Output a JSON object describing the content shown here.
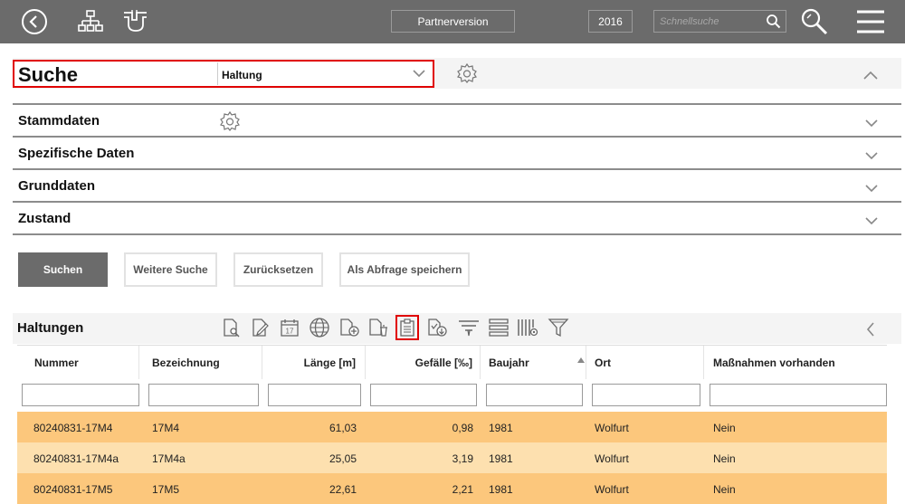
{
  "topbar": {
    "partner_label": "Partnerversion",
    "year": "2016",
    "quicksearch_placeholder": "Schnellsuche",
    "icons": [
      "back-icon",
      "network-icon",
      "pipe-icon",
      "search-icon",
      "zoom-search-icon",
      "menu-icon"
    ]
  },
  "search": {
    "title": "Suche",
    "selected": "Haltung"
  },
  "sections": [
    {
      "label": "Stammdaten"
    },
    {
      "label": "Spezifische Daten"
    },
    {
      "label": "Grunddaten"
    },
    {
      "label": "Zustand"
    }
  ],
  "buttons": {
    "search": "Suchen",
    "more": "Weitere Suche",
    "reset": "Zurücksetzen",
    "save_query": "Als Abfrage speichern"
  },
  "list": {
    "title": "Haltungen",
    "toolbar": [
      "document-search-icon",
      "document-edit-icon",
      "calendar-icon",
      "globe-icon",
      "document-add-icon",
      "document-delete-icon",
      "clipboard-icon",
      "document-export-icon",
      "highlighter-icon",
      "rows-icon",
      "columns-settings-icon",
      "filter-icon"
    ]
  },
  "table": {
    "columns": [
      "Nummer",
      "Bezeichnung",
      "Länge [m]",
      "Gefälle [‰]",
      "Baujahr",
      "Ort",
      "Maßnahmen vorhanden"
    ],
    "rows": [
      [
        "80240831-17M4",
        "17M4",
        "61,03",
        "0,98",
        "1981",
        "Wolfurt",
        "Nein"
      ],
      [
        "80240831-17M4a",
        "17M4a",
        "25,05",
        "3,19",
        "1981",
        "Wolfurt",
        "Nein"
      ],
      [
        "80240831-17M5",
        "17M5",
        "22,61",
        "2,21",
        "1981",
        "Wolfurt",
        "Nein"
      ]
    ]
  },
  "colors": {
    "topbar": "#6b6b6b",
    "row_even": "#fcc77c",
    "row_odd": "#fde0af",
    "highlight": "#e00000"
  }
}
